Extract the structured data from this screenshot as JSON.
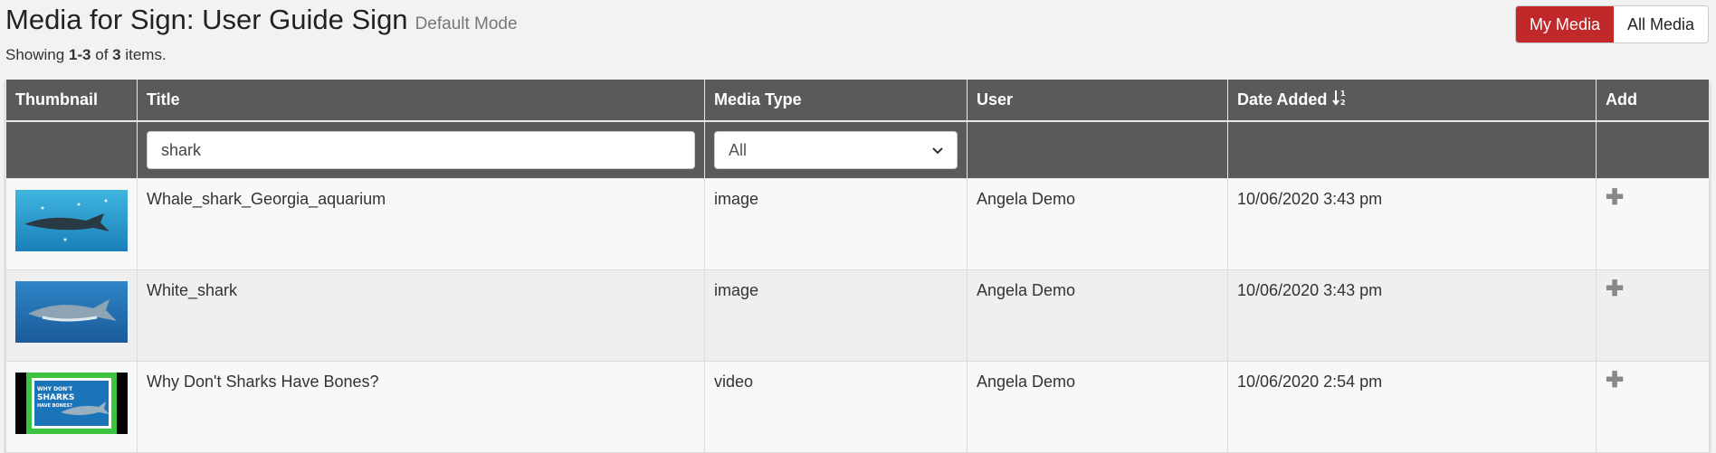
{
  "header": {
    "title": "Media for Sign: User Guide Sign",
    "mode": "Default Mode",
    "summary_prefix": "Showing ",
    "summary_range": "1-3",
    "summary_of": " of ",
    "summary_total": "3",
    "summary_suffix": " items."
  },
  "toggle": {
    "my_media": "My Media",
    "all_media": "All Media",
    "active": "My Media"
  },
  "colors": {
    "accent": "#c0282a",
    "header_bg": "#5a5a5a"
  },
  "columns": [
    "Thumbnail",
    "Title",
    "Media Type",
    "User",
    "Date Added",
    "Add"
  ],
  "filters": {
    "title_value": "shark",
    "media_type_selected": "All"
  },
  "rows": [
    {
      "title": "Whale_shark_Georgia_aquarium",
      "type": "image",
      "user": "Angela Demo",
      "date": "10/06/2020 3:43 pm",
      "thumbnail": "whale-shark-thumbnail"
    },
    {
      "title": "White_shark",
      "type": "image",
      "user": "Angela Demo",
      "date": "10/06/2020 3:43 pm",
      "thumbnail": "white-shark-thumbnail"
    },
    {
      "title": "Why Don't Sharks Have Bones?",
      "type": "video",
      "user": "Angela Demo",
      "date": "10/06/2020 2:54 pm",
      "thumbnail": "video-thumbnail"
    }
  ],
  "thumb3_text": [
    "WHY DON'T",
    "SHARKS",
    "HAVE BONES?"
  ],
  "icons": {
    "sort": "sort-descending-icon",
    "add": "plus-icon",
    "select": "chevron-down-icon"
  }
}
